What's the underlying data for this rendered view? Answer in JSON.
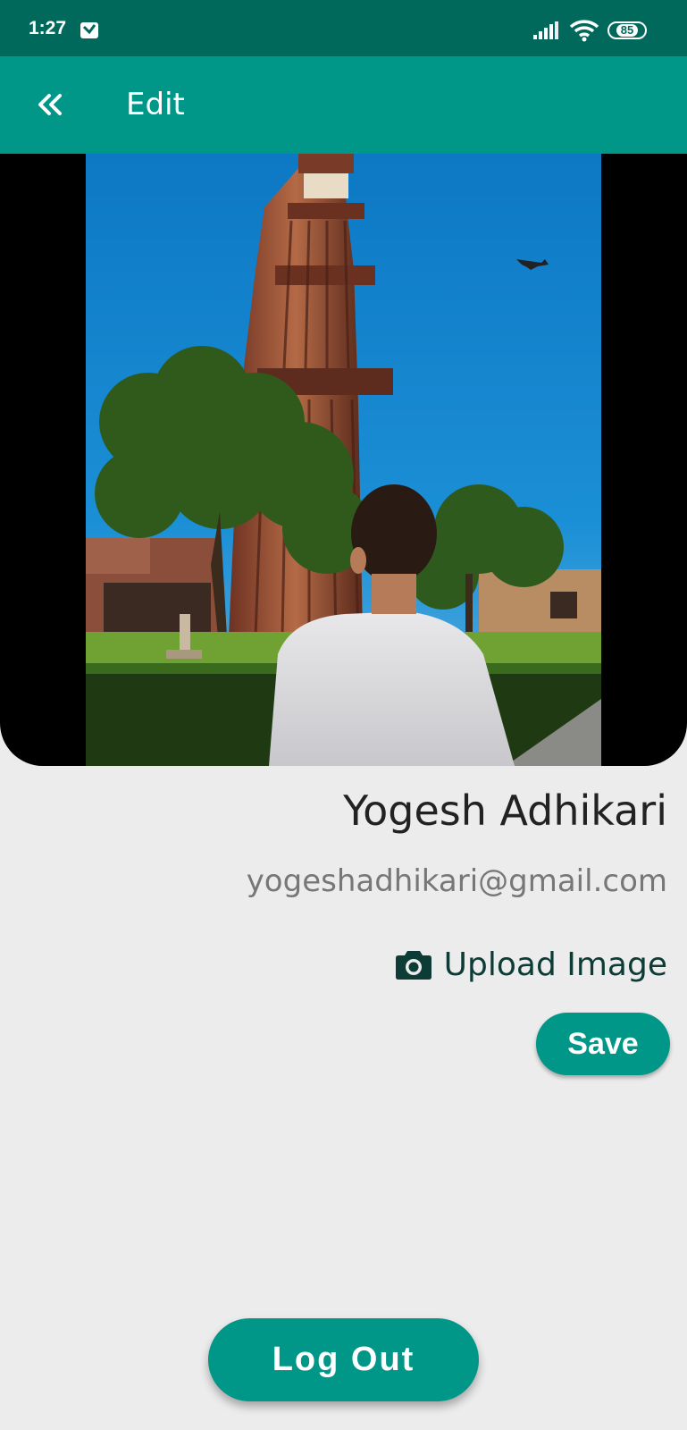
{
  "status_bar": {
    "time": "1:27",
    "battery": "85",
    "icons": [
      "app-notification-icon",
      "signal-icon",
      "wifi-icon",
      "battery-icon"
    ]
  },
  "app_bar": {
    "title": "Edit",
    "back_icon": "double-chevron-left-icon"
  },
  "profile": {
    "name": "Yogesh Adhikari",
    "email": "yogeshadhikari@gmail.com",
    "upload_label": "Upload Image",
    "upload_icon": "camera-icon"
  },
  "actions": {
    "save_label": "Save",
    "logout_label": "Log Out"
  },
  "colors": {
    "status_bar": "#00695c",
    "primary": "#009688",
    "background": "#ececec"
  }
}
